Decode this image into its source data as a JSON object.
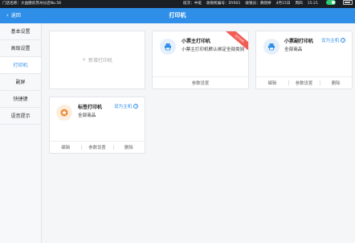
{
  "statusbar": {
    "store": "门店名称：大益膳房苏州分店No.56",
    "shift": "班次：中班",
    "cashier_no": "收银机编号：DY001",
    "cashier": "收银员：黄晓婷",
    "date": "4月15日",
    "weekday": "周四",
    "time": "15:21"
  },
  "header": {
    "back_label": "返回",
    "title": "打印机"
  },
  "sidebar": {
    "items": [
      {
        "label": "基本设置"
      },
      {
        "label": "高级设置"
      },
      {
        "label": "打印机"
      },
      {
        "label": "副屏"
      },
      {
        "label": "快捷键"
      },
      {
        "label": "语音提示"
      }
    ]
  },
  "add_printer": {
    "label": "新增打印机"
  },
  "printers": [
    {
      "name": "小票主打印机",
      "desc": "小票主打印机默认绑定全部类别",
      "ribbon": "主打印机",
      "footer": {
        "params": "参数设置"
      }
    },
    {
      "name": "小票副打印机",
      "desc": "全部商品",
      "set_main": "设为主机",
      "footer": {
        "edit": "编辑",
        "params": "参数设置",
        "delete": "删除"
      }
    },
    {
      "name": "标签打印机",
      "desc": "全部商品",
      "set_main": "设为主机",
      "footer": {
        "edit": "编辑",
        "params": "参数设置",
        "delete": "删除"
      }
    }
  ],
  "icons": {
    "back": "chevron-left-icon",
    "add": "plus-icon",
    "receipt_printer": "printer-icon",
    "label_printer": "star-badge-icon",
    "help": "question-circle-icon"
  },
  "colors": {
    "accent": "#2f8fe8",
    "ribbon": "#f25c54",
    "label_icon": "#f0892e"
  }
}
